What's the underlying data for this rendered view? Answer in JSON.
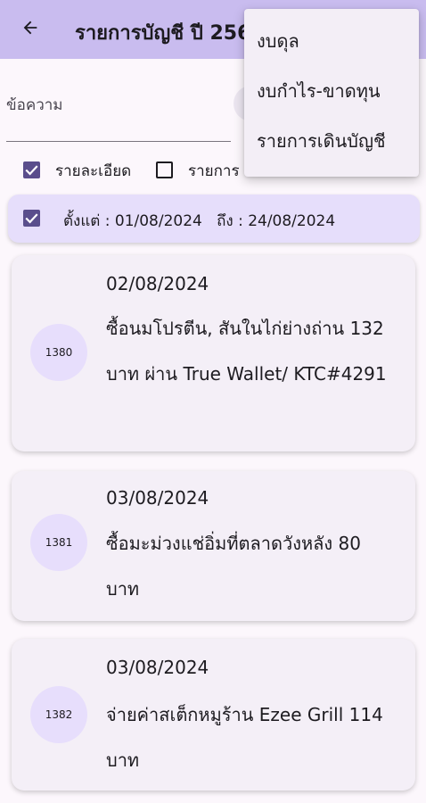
{
  "appbar": {
    "title": "รายการบัญชี ปี 2567",
    "back_icon": "arrow-back-icon",
    "background": "#c9bcef"
  },
  "menu": {
    "items": [
      {
        "label": "งบดุล"
      },
      {
        "label": "งบกำไร-ขาดทุน"
      },
      {
        "label": "รายการเดินบัญชี"
      }
    ]
  },
  "search": {
    "label": "ข้อความ"
  },
  "options": {
    "detail": {
      "label": "รายละเอียด",
      "checked": true
    },
    "entries": {
      "label": "รายการ",
      "checked": false
    }
  },
  "date_filter": {
    "checked": true,
    "text": "ตั้งแต่ : 01/08/2024   ถึง : 24/08/2024"
  },
  "entries": [
    {
      "id": "1380",
      "date": "02/08/2024",
      "description": "ซื้อนมโปรตีน, สันในไก่ย่างถ่าน 132 บาท ผ่าน True Wallet/ KTC#4291"
    },
    {
      "id": "1381",
      "date": "03/08/2024",
      "description": "ซื้อมะม่วงแช่อิ่มที่ตลาดวังหลัง 80 บาท"
    },
    {
      "id": "1382",
      "date": "03/08/2024",
      "description": "จ่ายค่าสเต็กหมูร้าน Ezee Grill 114 บาท"
    }
  ],
  "colors": {
    "accent": "#5a4e8c",
    "card": "#f4eff7",
    "badge": "#e7defc"
  }
}
